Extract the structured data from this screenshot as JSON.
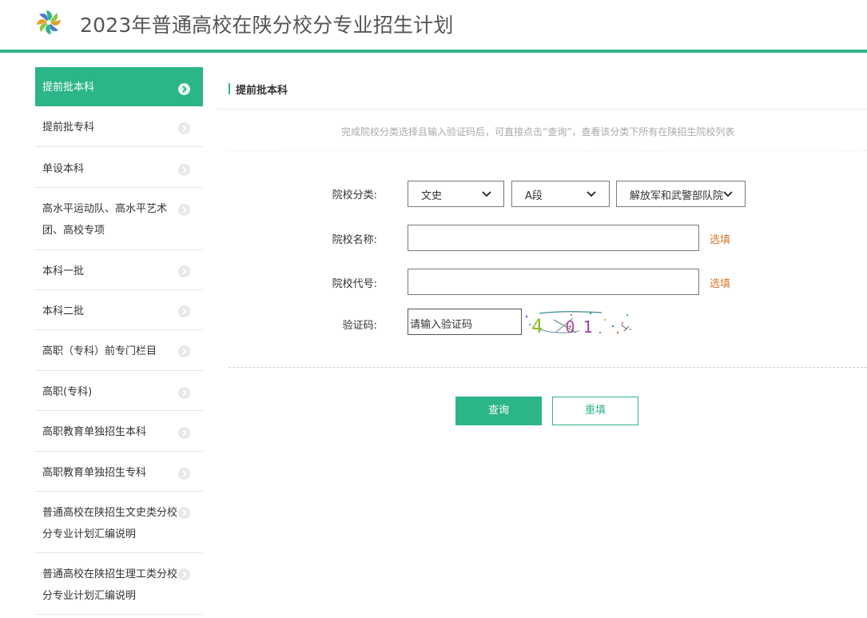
{
  "header": {
    "title": "2023年普通高校在陕分校分专业招生计划",
    "logo_icon": "pinwheel-logo"
  },
  "colors": {
    "accent": "#2db58a",
    "link": "#d5782c",
    "text": "#333333",
    "hint": "#aaaaaa"
  },
  "sidebar": {
    "items": [
      {
        "label": "提前批本科",
        "active": true
      },
      {
        "label": "提前批专科"
      },
      {
        "label": "单设本科"
      },
      {
        "label": "高水平运动队、高水平艺术团、高校专项"
      },
      {
        "label": "本科一批"
      },
      {
        "label": "本科二批"
      },
      {
        "label": "高职（专科）前专门栏目"
      },
      {
        "label": "高职(专科)"
      },
      {
        "label": "高职教育单独招生本科"
      },
      {
        "label": "高职教育单独招生专科"
      },
      {
        "label": "普通高校在陕招生文史类分校分专业计划汇编说明"
      },
      {
        "label": "普通高校在陕招生理工类分校分专业计划汇编说明"
      }
    ]
  },
  "main": {
    "title": "提前批本科",
    "hint": "完成院校分类选择且输入验证码后，可直接点击“查询”，查看该分类下所有在陕招生院校列表",
    "form": {
      "category_label": "院校分类:",
      "category_selects": [
        "文史",
        "A段",
        "解放军和武警部队院"
      ],
      "name_label": "院校名称:",
      "name_value": "",
      "code_label": "院校代号:",
      "code_value": "",
      "pick_link": "选填",
      "captcha_label": "验证码:",
      "captcha_placeholder": "请输入验证码",
      "captcha_text": "4 0 1"
    },
    "buttons": {
      "query": "查询",
      "reset": "重填"
    }
  }
}
